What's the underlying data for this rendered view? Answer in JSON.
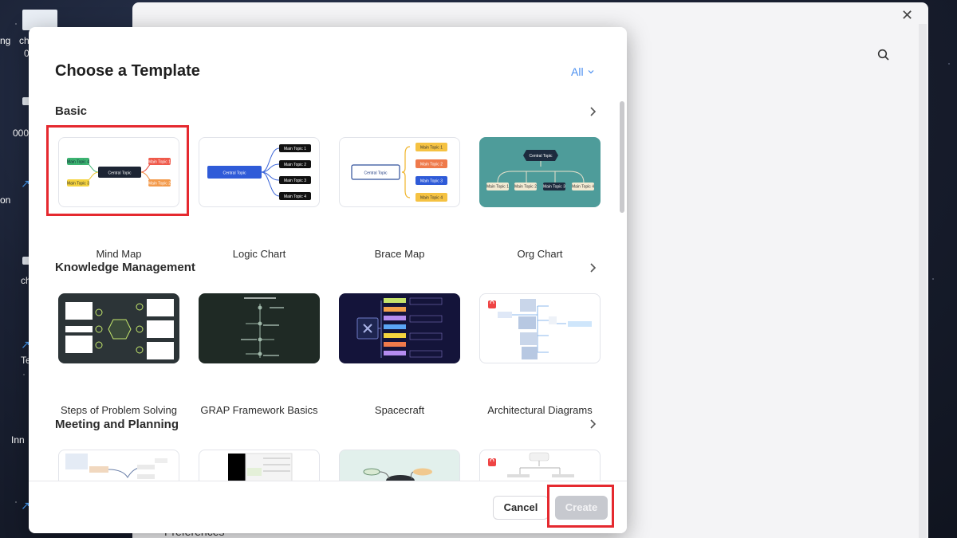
{
  "desktop": {
    "labels": [
      "ng",
      "ch",
      "0",
      "000",
      "on",
      "ch",
      "Te",
      "Inn"
    ]
  },
  "background_window": {
    "preferences_label": "Preferences"
  },
  "dialog": {
    "title": "Choose a Template",
    "filter_label": "All",
    "sections": [
      {
        "title": "Basic",
        "templates": [
          {
            "label": "Mind Map",
            "selected": true
          },
          {
            "label": "Logic Chart"
          },
          {
            "label": "Brace Map"
          },
          {
            "label": "Org Chart"
          }
        ]
      },
      {
        "title": "Knowledge Management",
        "templates": [
          {
            "label": "Steps of Problem Solving"
          },
          {
            "label": "GRAP Framework Basics"
          },
          {
            "label": "Spacecraft"
          },
          {
            "label": "Architectural Diagrams",
            "locked": true
          }
        ]
      },
      {
        "title": "Meeting and Planning",
        "templates": [
          {
            "label": ""
          },
          {
            "label": ""
          },
          {
            "label": ""
          },
          {
            "label": "",
            "locked": true
          }
        ]
      }
    ],
    "thumb_text": {
      "central_topic": "Central Topic",
      "main_topic_1": "Main Topic 1",
      "main_topic_2": "Main Topic 2",
      "main_topic_3": "Main Topic 3",
      "main_topic_4": "Main Topic 4"
    },
    "cancel_label": "Cancel",
    "create_label": "Create"
  },
  "colors": {
    "accent": "#4a8ff0",
    "highlight": "#e5292f",
    "org_chart_bg": "#4e9c9a"
  }
}
